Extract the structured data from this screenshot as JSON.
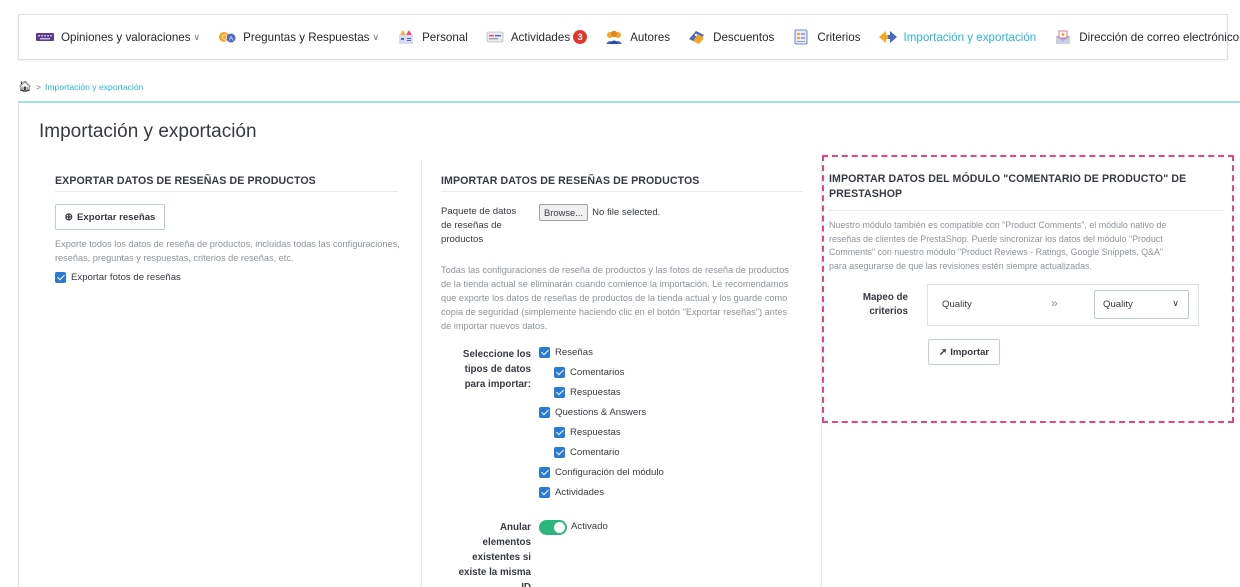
{
  "nav": {
    "items": [
      {
        "label": "Opiniones y valoraciones",
        "icon": "keyboard-icon",
        "dropdown": true
      },
      {
        "label": "Preguntas y Respuestas",
        "icon": "qa-icon",
        "dropdown": true
      },
      {
        "label": "Personal",
        "icon": "personal-icon"
      },
      {
        "label": "Actividades",
        "icon": "activities-icon",
        "badge": "3"
      },
      {
        "label": "Autores",
        "icon": "authors-icon"
      },
      {
        "label": "Descuentos",
        "icon": "discounts-icon"
      },
      {
        "label": "Criterios",
        "icon": "criteria-icon"
      },
      {
        "label": "Importación y exportación",
        "icon": "import-export-icon",
        "active": true
      },
      {
        "label": "Dirección de correo electrónico",
        "icon": "email-icon",
        "dropdown": true
      }
    ],
    "more": "..."
  },
  "breadcrumb": {
    "current": "Importación y exportación"
  },
  "page": {
    "title": "Importación y exportación"
  },
  "export": {
    "heading": "EXPORTAR DATOS DE RESEÑAS DE PRODUCTOS",
    "button": "Exportar reseñas",
    "description_1": "Exporte todos los datos de reseña de productos, incluidas todas las configuraciones,",
    "description_2": "reseñas, preguntas y respuestas, criterios de reseñas, etc.",
    "photos_checkbox": "Exportar fotos de reseñas"
  },
  "import": {
    "heading": "IMPORTAR DATOS DE RESEÑAS DE PRODUCTOS",
    "package_label_1": "Paquete de datos",
    "package_label_2": "de reseñas de",
    "package_label_3": "productos",
    "browse": "Browse...",
    "no_file": "No file selected.",
    "warning": [
      "Todas las configuraciones de reseña de productos y las fotos de reseña de productos",
      "de la tienda actual se eliminarán cuando comience la importación. Le recomendamos",
      "que exporte los datos de reseñas de productos de la tienda actual y los guarde como",
      "copia de seguridad (simplemente haciendo clic en el botón \"Exportar reseñas\") antes",
      "de importar nuevos datos."
    ],
    "types_label": [
      "Seleccione los",
      "tipos de datos",
      "para importar:"
    ],
    "types": [
      {
        "label": "Reseñas",
        "level": 0
      },
      {
        "label": "Comentarios",
        "level": 1
      },
      {
        "label": "Respuestas",
        "level": 1
      },
      {
        "label": "Questions & Answers",
        "level": 0
      },
      {
        "label": "Respuestas",
        "level": 1
      },
      {
        "label": "Comentario",
        "level": 1
      },
      {
        "label": "Configuración del módulo",
        "level": 0
      },
      {
        "label": "Actividades",
        "level": 0
      }
    ],
    "override_label": [
      "Anular",
      "elementos",
      "existentes si",
      "existe la misma",
      "ID"
    ],
    "override_state": "Activado"
  },
  "comments_import": {
    "heading_1": "IMPORTAR DATOS DEL MÓDULO \"COMENTARIO DE PRODUCTO\" DE",
    "heading_2": "PRESTASHOP",
    "description": [
      "Nuestro módulo también es compatible con \"Product Comments\", el módulo nativo de",
      "reseñas de clientes de PrestaShop. Puede sincronizar los datos del módulo \"Product",
      "Comments\" con nuestro módulo \"Product Reviews - Ratings, Google Snippets, Q&A\"",
      "para asegurarse de que las revisiones estén siempre actualizadas."
    ],
    "mapping_label_1": "Mapeo de",
    "mapping_label_2": "criterios",
    "source_criterion": "Quality",
    "arrow": "»",
    "target_criterion": "Quality",
    "import_button": "Importar"
  },
  "colors": {
    "accent": "#25b9d7",
    "dashed": "#e74386",
    "toggle": "#2db67c",
    "badge": "#e0362e"
  }
}
